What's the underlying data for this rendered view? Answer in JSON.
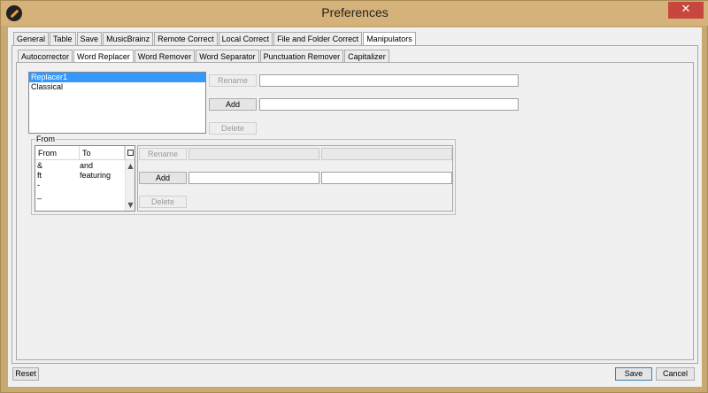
{
  "window": {
    "title": "Preferences",
    "close_glyph": "✕"
  },
  "main_tabs": [
    {
      "label": "General"
    },
    {
      "label": "Table"
    },
    {
      "label": "Save"
    },
    {
      "label": "MusicBrainz"
    },
    {
      "label": "Remote Correct"
    },
    {
      "label": "Local Correct"
    },
    {
      "label": "File and Folder Correct"
    },
    {
      "label": "Manipulators"
    }
  ],
  "sub_tabs": [
    {
      "label": "Autocorrector"
    },
    {
      "label": "Word Replacer"
    },
    {
      "label": "Word Remover"
    },
    {
      "label": "Word Separator"
    },
    {
      "label": "Punctuation Remover"
    },
    {
      "label": "Capitalizer"
    }
  ],
  "replacer_list": {
    "items": [
      "Replacer1",
      "Classical"
    ],
    "selected": "Replacer1"
  },
  "top_actions": {
    "rename": "Rename",
    "add": "Add",
    "delete": "Delete",
    "rename_value": "",
    "add_value": ""
  },
  "from_group": {
    "legend": "From",
    "columns": [
      "From",
      "To"
    ],
    "rows": [
      {
        "from": "&",
        "to": "and"
      },
      {
        "from": "ft",
        "to": "featuring"
      },
      {
        "from": "-",
        "to": ""
      },
      {
        "from": "_",
        "to": ""
      }
    ],
    "rename": "Rename",
    "add": "Add",
    "delete": "Delete"
  },
  "footer": {
    "reset": "Reset",
    "save": "Save",
    "cancel": "Cancel"
  },
  "colors": {
    "window_frame": "#c9a972",
    "close": "#c7463d",
    "selection": "#3399ff"
  },
  "icons": {
    "app": "app-icon",
    "close": "close-icon",
    "table-settings": "table-settings-icon"
  }
}
